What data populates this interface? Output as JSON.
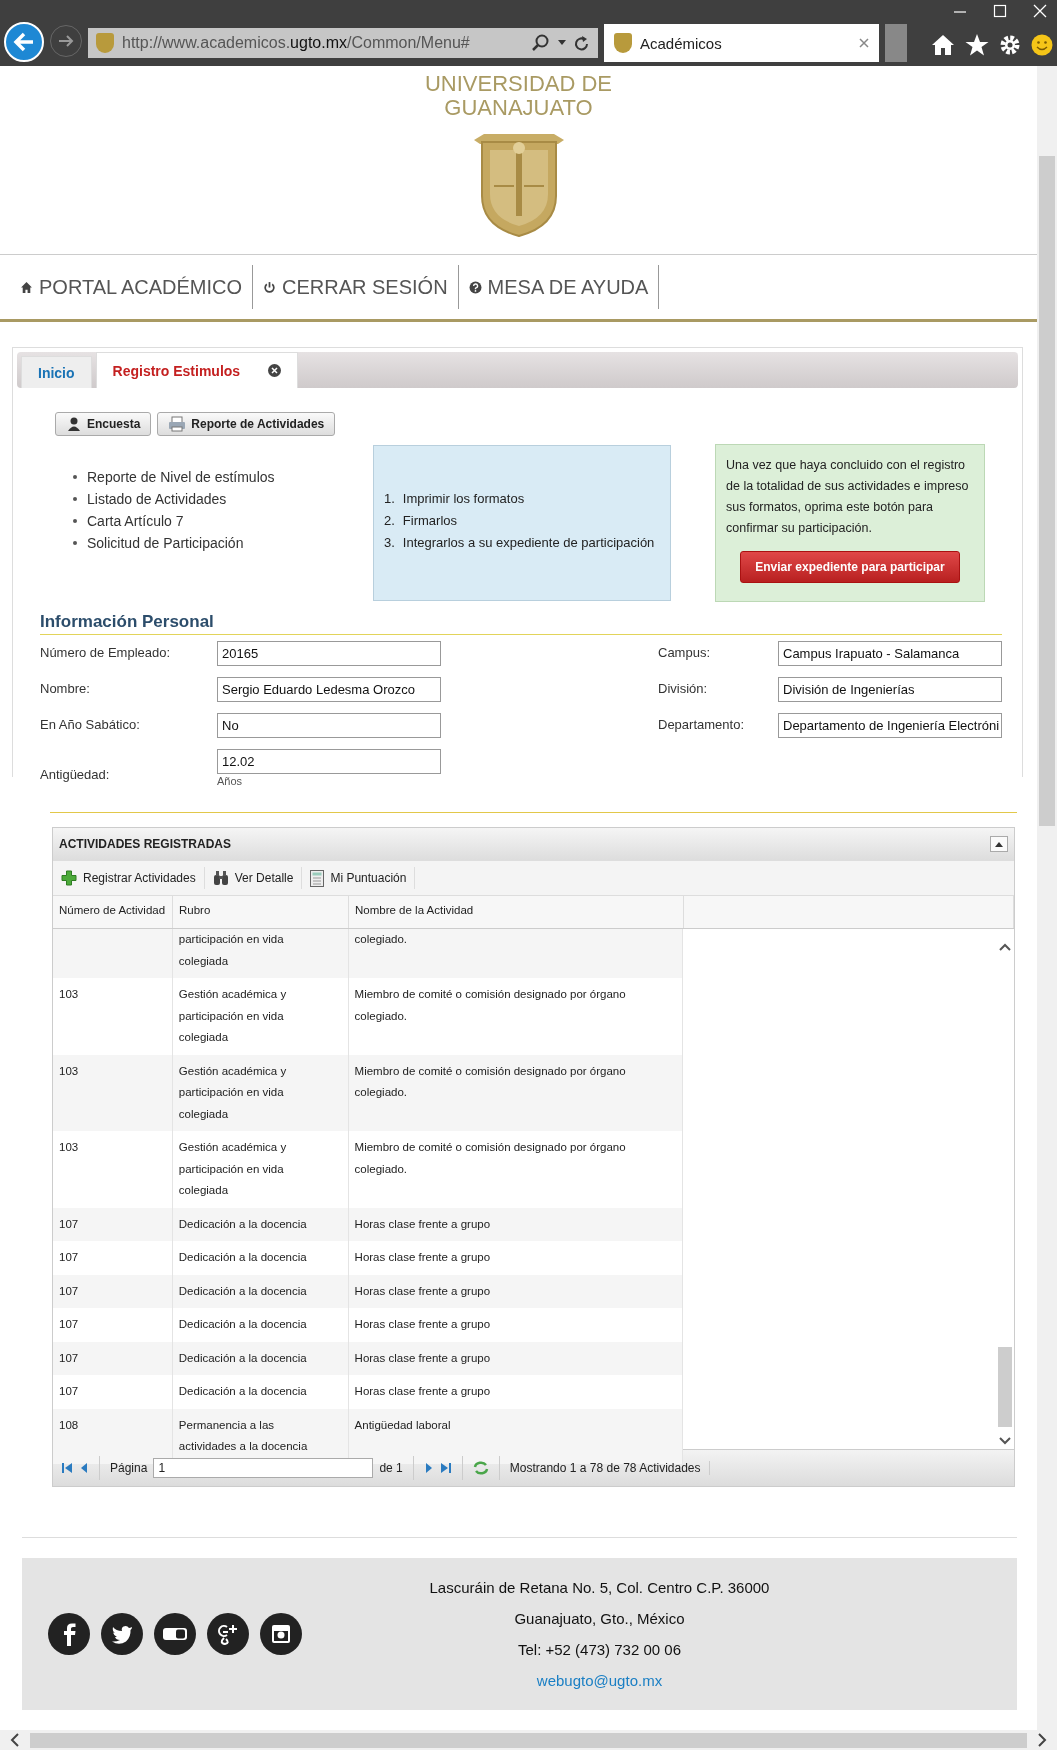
{
  "browser": {
    "url": {
      "prefix": "http://www.academicos.",
      "domain": "ugto.mx",
      "suffix": "/Common/Menu#"
    },
    "tab_title": "Académicos"
  },
  "header": {
    "lines": [
      "UNIVERSIDAD DE",
      "GUANAJUATO"
    ]
  },
  "nav": [
    {
      "kind": "home",
      "label": "PORTAL ACADÉMICO"
    },
    {
      "kind": "power",
      "label": "CERRAR SESIÓN"
    },
    {
      "kind": "help",
      "label": "MESA DE AYUDA"
    }
  ],
  "tabs": [
    {
      "label": "Inicio",
      "selected": false,
      "closable": false
    },
    {
      "label": "Registro Estimulos",
      "selected": true,
      "closable": true
    }
  ],
  "toolbar": [
    {
      "kind": "person",
      "label": "Encuesta"
    },
    {
      "kind": "printer",
      "label": "Reporte de Actividades"
    }
  ],
  "links": [
    "Reporte de Nivel de estímulos",
    "Listado de Actividades",
    "Carta Artículo 7",
    "Solicitud de Participación"
  ],
  "steps": [
    {
      "number": "1.",
      "text": "Imprimir los formatos"
    },
    {
      "number": "2.",
      "text": "Firmarlos"
    },
    {
      "number": "3.",
      "text": "Integrarlos a su expediente de participación"
    }
  ],
  "notice": {
    "text": "Una vez que haya concluido con el registro de la totalidad de sus actividades e impreso sus formatos, oprima este botón para confirmar su participación.",
    "button": "Enviar expediente para participar"
  },
  "personal_info": {
    "title": "Información Personal",
    "left": [
      {
        "label": "Número de Empleado:",
        "value": "20165"
      },
      {
        "label": "Nombre:",
        "value": "Sergio Eduardo Ledesma Orozco"
      },
      {
        "label": "En Año Sabático:",
        "value": "No"
      },
      {
        "label": "Antigüedad:",
        "value": "12.02",
        "unit": "Años"
      }
    ],
    "right": [
      {
        "label": "Campus:",
        "value": "Campus Irapuato - Salamanca"
      },
      {
        "label": "División:",
        "value": "División de Ingenierías"
      },
      {
        "label": "Departamento:",
        "value": "Departamento de Ingeniería Electróni"
      }
    ]
  },
  "grid": {
    "title": "ACTIVIDADES REGISTRADAS",
    "actions": [
      {
        "kind": "add",
        "label": "Registrar Actividades"
      },
      {
        "kind": "binoculars",
        "label": "Ver Detalle"
      },
      {
        "kind": "calculator",
        "label": "Mi Puntuación"
      }
    ],
    "columns": [
      "Número de Actividad",
      "Rubro",
      "Nombre de la Actividad"
    ],
    "rows": [
      {
        "number": "",
        "rubro": "participación en vida colegiada",
        "nombre": "colegiado."
      },
      {
        "number": "103",
        "rubro": "Gestión académica y participación en vida colegiada",
        "nombre": "Miembro de comité o comisión designado por órgano colegiado."
      },
      {
        "number": "103",
        "rubro": "Gestión académica y participación en vida colegiada",
        "nombre": "Miembro de comité o comisión designado por órgano colegiado."
      },
      {
        "number": "103",
        "rubro": "Gestión académica y participación en vida colegiada",
        "nombre": "Miembro de comité o comisión designado por órgano colegiado."
      },
      {
        "number": "107",
        "rubro": "Dedicación a la docencia",
        "nombre": "Horas clase frente a grupo"
      },
      {
        "number": "107",
        "rubro": "Dedicación a la docencia",
        "nombre": "Horas clase frente a grupo"
      },
      {
        "number": "107",
        "rubro": "Dedicación a la docencia",
        "nombre": "Horas clase frente a grupo"
      },
      {
        "number": "107",
        "rubro": "Dedicación a la docencia",
        "nombre": "Horas clase frente a grupo"
      },
      {
        "number": "107",
        "rubro": "Dedicación a la docencia",
        "nombre": "Horas clase frente a grupo"
      },
      {
        "number": "107",
        "rubro": "Dedicación a la docencia",
        "nombre": "Horas clase frente a grupo"
      },
      {
        "number": "108",
        "rubro": "Permanencia a las actividades a la docencia",
        "nombre": "Antigüedad laboral"
      }
    ],
    "pager": {
      "page_label": "Página",
      "page": "1",
      "of": "de 1",
      "status": "Mostrando 1 a 78 de 78 Actividades"
    }
  },
  "footer": {
    "lines": [
      "Lascuráin de Retana No. 5, Col. Centro C.P. 36000",
      "Guanajuato, Gto., México",
      "Tel: +52 (473) 732 00 06"
    ],
    "email": "webugto@ugto.mx"
  }
}
